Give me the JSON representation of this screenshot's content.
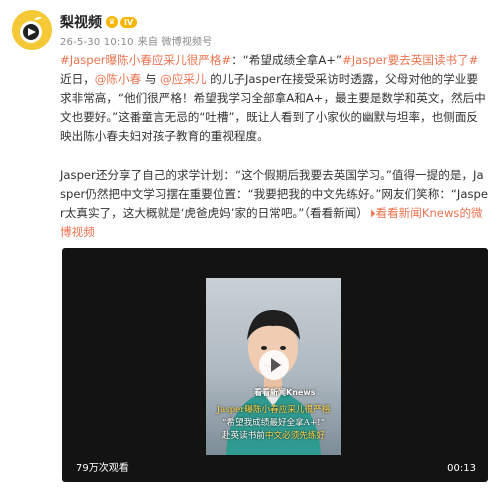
{
  "post": {
    "username": "梨视频",
    "vip_badge": "IV",
    "date": "26-5-30 10:10",
    "source": "来自 微博视频号",
    "p1": {
      "tag1": "#Jasper曝陈小春应采儿很严格#",
      "t1": "：“希望成绩全拿A+”",
      "tag2": "#Jasper要去英国读书了#",
      "t2": " 近日，",
      "at1": "@陈小春",
      "t3": " 与 ",
      "at2": "@应采儿",
      "t4": " 的儿子Jasper在接受采访时透露，父母对他的学业要求非常高，“他们很严格！希望我学习全部拿A和A+，最主要是数学和英文，然后中文也要好。”这番童言无忌的“吐槽”，既让人看到了小家伙的幽默与坦率，也侧面反映出陈小春夫妇对孩子教育的重视程度。"
    },
    "p2": {
      "t1": "Jasper还分享了自己的求学计划：“这个假期后我要去英国学习。”值得一提的是，Jasper仍然把中文学习摆在重要位置：“我要把我的中文先练好。”网友们笑称：“Jasper太真实了，这大概就是‘虎爸虎妈’家的日常吧。”（看看新闻）",
      "link": "看看新闻Knews的微博视频"
    }
  },
  "video": {
    "watermark": "看看新闻Knews",
    "caption1": "Jasper曝陈小春应采儿很严格",
    "caption2": "“希望我成绩最好全拿A+!”",
    "caption3a": "赴英读书前",
    "caption3b": "中文必须先练好",
    "views": "79万次观看",
    "duration": "00:13"
  },
  "colors": {
    "link": "#eb7350",
    "avatar_bg": "#f4c935",
    "video_bg": "#131313",
    "caption_yellow": "#ffd84a"
  },
  "icons": {
    "avatar": "pear-video-logo-icon",
    "vip": "crown-icon",
    "link": "video-link-icon",
    "play": "play-icon"
  }
}
